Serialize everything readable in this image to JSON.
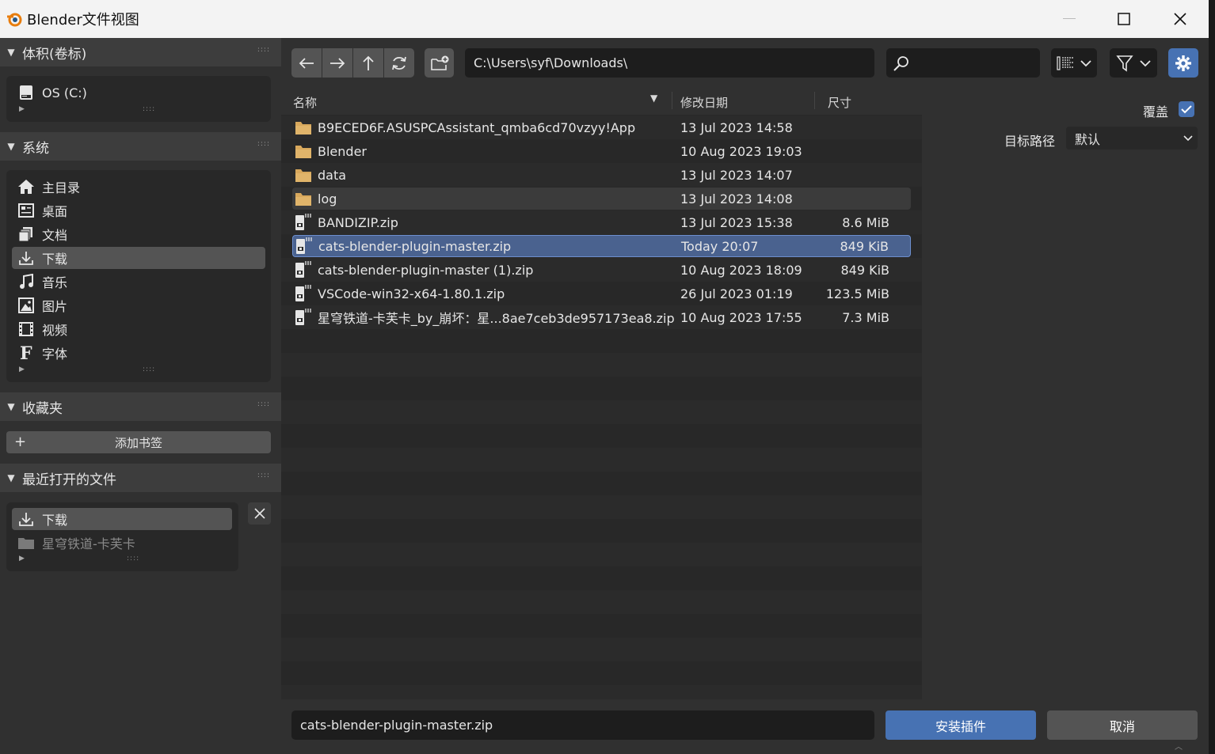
{
  "window": {
    "title": "Blender文件视图"
  },
  "sidebar": {
    "volumes": {
      "header": "体积(卷标)",
      "items": [
        {
          "label": "OS (C:)",
          "icon": "disk-icon"
        }
      ]
    },
    "system": {
      "header": "系统",
      "items": [
        {
          "label": "主目录",
          "icon": "home-icon"
        },
        {
          "label": "桌面",
          "icon": "desktop-icon"
        },
        {
          "label": "文档",
          "icon": "documents-icon"
        },
        {
          "label": "下载",
          "icon": "download-icon",
          "active": true
        },
        {
          "label": "音乐",
          "icon": "music-icon"
        },
        {
          "label": "图片",
          "icon": "image-icon"
        },
        {
          "label": "视频",
          "icon": "video-icon"
        },
        {
          "label": "字体",
          "icon": "font-icon"
        }
      ]
    },
    "bookmarks": {
      "header": "收藏夹",
      "add_label": "添加书签"
    },
    "recent": {
      "header": "最近打开的文件",
      "items": [
        {
          "label": "下载",
          "icon": "download-icon",
          "active": true
        },
        {
          "label": "星穹铁道-卡芙卡",
          "icon": "folder-icon",
          "dim": true
        }
      ]
    }
  },
  "toolbar": {
    "path": "C:\\Users\\syf\\Downloads\\",
    "search_value": ""
  },
  "file_list": {
    "columns": {
      "name": "名称",
      "date": "修改日期",
      "size": "尺寸"
    },
    "rows": [
      {
        "name": "B9ECED6F.ASUSPCAssistant_qmba6cd70vzyy!App",
        "date": "13 Jul 2023 14:58",
        "size": "",
        "type": "folder"
      },
      {
        "name": "Blender",
        "date": "10 Aug 2023 19:03",
        "size": "",
        "type": "folder"
      },
      {
        "name": "data",
        "date": "13 Jul 2023 14:07",
        "size": "",
        "type": "folder"
      },
      {
        "name": "log",
        "date": "13 Jul 2023 14:08",
        "size": "",
        "type": "folder",
        "hover": true
      },
      {
        "name": "BANDIZIP.zip",
        "date": "13 Jul 2023 15:38",
        "size": "8.6 MiB",
        "type": "zip"
      },
      {
        "name": "cats-blender-plugin-master.zip",
        "date": "Today 20:07",
        "size": "849 KiB",
        "type": "zip",
        "selected": true
      },
      {
        "name": "cats-blender-plugin-master (1).zip",
        "date": "10 Aug 2023 18:09",
        "size": "849 KiB",
        "type": "zip"
      },
      {
        "name": "VSCode-win32-x64-1.80.1.zip",
        "date": "26 Jul 2023 01:19",
        "size": "123.5 MiB",
        "type": "zip"
      },
      {
        "name": "星穹铁道-卡芙卡_by_崩坏：星...8ae7ceb3de957173ea8.zip",
        "date": "10 Aug 2023 17:55",
        "size": "7.3 MiB",
        "type": "zip"
      }
    ]
  },
  "properties": {
    "overwrite_label": "覆盖",
    "overwrite_checked": true,
    "target_label": "目标路径",
    "target_value": "默认"
  },
  "bottom": {
    "filename": "cats-blender-plugin-master.zip",
    "install_label": "安装插件",
    "cancel_label": "取消"
  },
  "colors": {
    "accent": "#4772b3",
    "selection": "#4a628f",
    "panel": "#303030",
    "field": "#1d1d1d"
  }
}
